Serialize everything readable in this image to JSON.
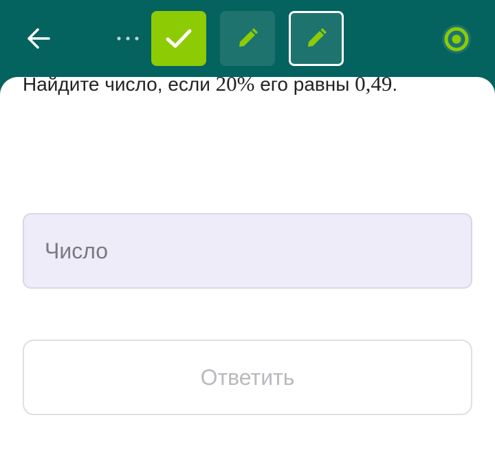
{
  "colors": {
    "header_bg": "#04625f",
    "accent_green": "#8dcb04",
    "step_tile_bg": "#1e736f",
    "input_bg": "#efecfa",
    "disabled_text": "#b9b9bd"
  },
  "header": {
    "back_icon": "arrow-left-icon",
    "more_icon": "more-horizontal-icon",
    "steps": [
      {
        "state": "completed",
        "icon": "check-icon"
      },
      {
        "state": "pending",
        "icon": "pencil-icon"
      },
      {
        "state": "current",
        "icon": "pencil-icon"
      }
    ],
    "progress_icon": "progress-ring-icon"
  },
  "task": {
    "text_1": "Найдите число, если ",
    "math_1": "20%",
    "text_2": " его равны ",
    "math_2": "0,49",
    "text_3": "."
  },
  "answer": {
    "placeholder": "Число",
    "value": ""
  },
  "submit": {
    "label": "Ответить",
    "enabled": false
  }
}
